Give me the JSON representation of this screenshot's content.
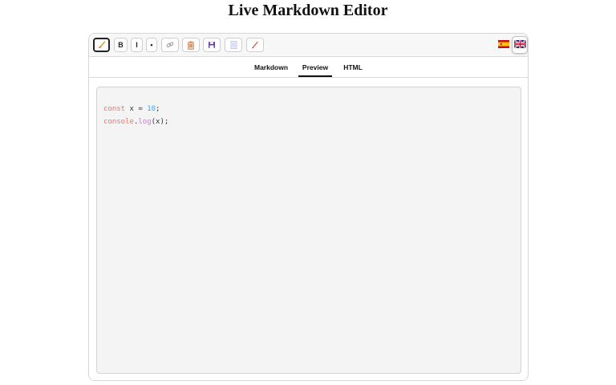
{
  "page": {
    "title": "Live Markdown Editor"
  },
  "toolbar": {
    "bold_label": "B",
    "italic_label": "I",
    "bullet_label": "•",
    "icons": [
      "brush-icon",
      "link-icon",
      "clipboard-icon",
      "save-icon",
      "document-icon",
      "pen-icon"
    ]
  },
  "languages": [
    "es",
    "en"
  ],
  "tabs": [
    {
      "label": "Markdown",
      "active": false
    },
    {
      "label": "Preview",
      "active": true
    },
    {
      "label": "HTML",
      "active": false
    }
  ],
  "preview": {
    "code": {
      "line1": {
        "keyword": "const",
        "ident": " x = ",
        "number": "10",
        "end": ";"
      },
      "line2": {
        "object": "console",
        "dot": ".",
        "method": "log",
        "args": "(x);"
      }
    }
  },
  "colors": {
    "keyword": "#e8756a",
    "number": "#4aa3df",
    "method": "#c678dd",
    "active_border": "#222222"
  }
}
